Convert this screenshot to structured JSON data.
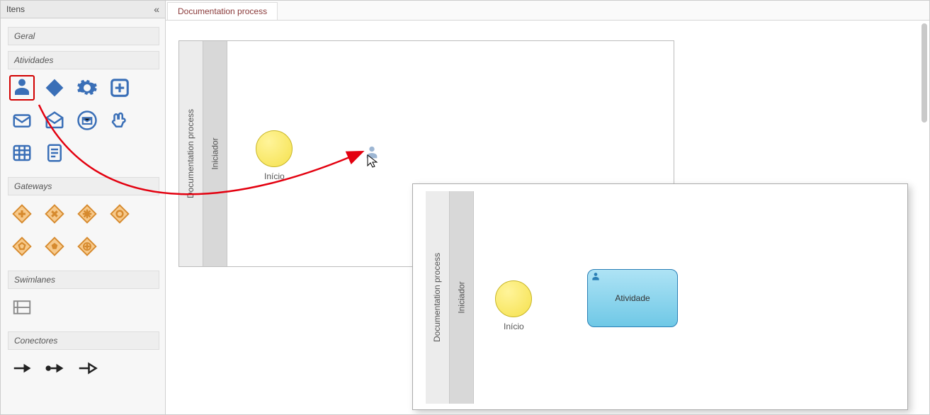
{
  "sidebar": {
    "title": "Itens",
    "sections": {
      "geral": "Geral",
      "atividades": "Atividades",
      "gateways": "Gateways",
      "swimlanes": "Swimlanes",
      "conectores": "Conectores"
    },
    "activity_items": [
      {
        "name": "user-task-icon",
        "selected": true
      },
      {
        "name": "diamond-icon"
      },
      {
        "name": "gear-icon"
      },
      {
        "name": "plus-box-icon"
      },
      {
        "name": "envelope-icon"
      },
      {
        "name": "envelope-open-icon"
      },
      {
        "name": "envelope-circle-icon"
      },
      {
        "name": "hand-point-icon"
      },
      {
        "name": "table-icon"
      },
      {
        "name": "document-icon"
      }
    ],
    "gateway_items": [
      {
        "name": "gateway-plus-icon"
      },
      {
        "name": "gateway-x-icon"
      },
      {
        "name": "gateway-star-icon"
      },
      {
        "name": "gateway-circle-icon"
      },
      {
        "name": "gateway-pentagon-icon"
      },
      {
        "name": "gateway-pentagon2-icon"
      },
      {
        "name": "gateway-plus-alt-icon"
      }
    ],
    "swimlane_items": [
      {
        "name": "swimlane-icon"
      }
    ],
    "connector_items": [
      {
        "name": "arrow-solid-icon"
      },
      {
        "name": "arrow-dot-icon"
      },
      {
        "name": "arrow-open-icon"
      }
    ]
  },
  "tab": {
    "label": "Documentation process"
  },
  "pool1": {
    "title": "Documentation process",
    "lane": "Iniciador",
    "start_label": "Início"
  },
  "pool2": {
    "title": "Documentation process",
    "lane": "Iniciador",
    "start_label": "Início",
    "activity_label": "Atividade"
  }
}
